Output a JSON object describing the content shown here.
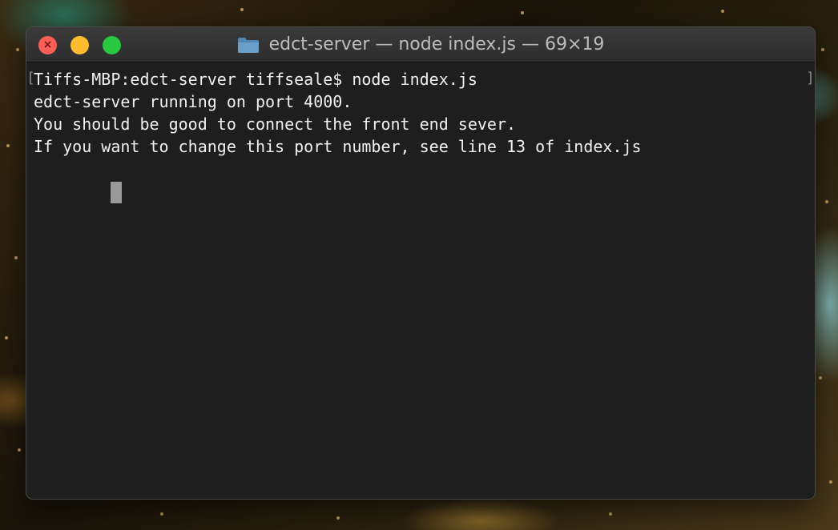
{
  "window": {
    "title": "edct-server — node index.js — 69×19",
    "folder_icon": "folder-icon",
    "close_icon": "close-icon"
  },
  "terminal": {
    "lines": [
      "Tiffs-MBP:edct-server tiffseale$ node index.js",
      "edct-server running on port 4000.",
      "You should be good to connect the front end sever.",
      "If you want to change this port number, see line 13 of index.js"
    ],
    "bracket_left": "[",
    "bracket_right": "]"
  },
  "colors": {
    "close": "#fd5f57",
    "minimize": "#febc2e",
    "maximize": "#28c840",
    "terminal_bg": "#1e1e1e",
    "text": "#f0f0f0"
  }
}
